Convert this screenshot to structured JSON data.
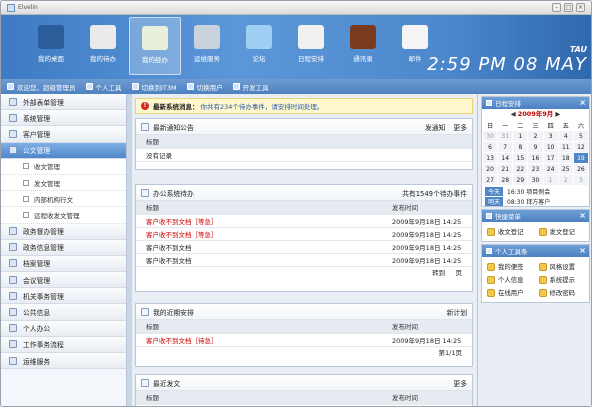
{
  "window": {
    "title": "Elvelin",
    "controls": [
      "–",
      "□",
      "×"
    ]
  },
  "nav": [
    {
      "label": "我的桌面",
      "icon": "monitor-icon",
      "color": "#2a5d99"
    },
    {
      "label": "我的待办",
      "icon": "clock-icon",
      "color": "#eaeaea"
    },
    {
      "label": "我的经办",
      "icon": "checklist-icon",
      "color": "#e8f0dc"
    },
    {
      "label": "运维服务",
      "icon": "gear-icon",
      "color": "#c9d3de"
    },
    {
      "label": "论坛",
      "icon": "speech-bubble-icon",
      "color": "#9fd0f3"
    },
    {
      "label": "日程安排",
      "icon": "calendar-icon",
      "color": "#f1f1f1"
    },
    {
      "label": "通讯录",
      "icon": "book-icon",
      "color": "#7a3b1e"
    },
    {
      "label": "邮件",
      "icon": "envelope-icon",
      "color": "#f4f4f4"
    }
  ],
  "nav_active_index": 2,
  "clock": {
    "day": "TAU",
    "time": "2:59 PM 08 MAY"
  },
  "toolbar": [
    {
      "label": "欢迎您，超级管理员",
      "icon": "user-icon"
    },
    {
      "label": "个人工具",
      "icon": "tools-icon"
    },
    {
      "label": "切换到IT3M",
      "icon": "switch-icon"
    },
    {
      "label": "切换用户",
      "icon": "users-icon"
    },
    {
      "label": "开发工具",
      "icon": "dev-tools-icon"
    }
  ],
  "sidebar": {
    "items": [
      {
        "label": "外部表单管理"
      },
      {
        "label": "系统管理"
      },
      {
        "label": "客户管理"
      },
      {
        "label": "公文管理",
        "open": true
      },
      {
        "label": "收文管理",
        "sub": true
      },
      {
        "label": "发文管理",
        "sub": true
      },
      {
        "label": "内部机构行文",
        "sub": true
      },
      {
        "label": "远程收发文管理",
        "sub": true
      },
      {
        "label": "政务督办管理"
      },
      {
        "label": "政务信息管理"
      },
      {
        "label": "档案管理"
      },
      {
        "label": "会议管理"
      },
      {
        "label": "机关事务管理"
      },
      {
        "label": "公共信息"
      },
      {
        "label": "个人办公"
      },
      {
        "label": "工作事务流程"
      },
      {
        "label": "运维服务"
      }
    ]
  },
  "alert": {
    "title": "最新系统消息：",
    "message": "你共有234个待办事件，请安排时间处理。"
  },
  "notice": {
    "title": "最新通知公告",
    "actions": [
      "发通知",
      "更多"
    ],
    "col": "标题",
    "empty": "没有记录"
  },
  "todo": {
    "title": "办公系统待办",
    "count": "共有1549个待办事件",
    "cols": [
      "标题",
      "发布时间"
    ],
    "rows": [
      {
        "title": "客户收不到文档［等急］",
        "time": "2009年9月18日 14:25",
        "urgent": true
      },
      {
        "title": "客户收不到文档［等急］",
        "time": "2009年9月18日 14:25",
        "urgent": true
      },
      {
        "title": "客户收不到文档",
        "time": "2009年9月18日 14:25",
        "urgent": false
      },
      {
        "title": "客户收不到文档",
        "time": "2009年9月18日 14:25",
        "urgent": false
      }
    ],
    "footer": [
      "转到",
      "页"
    ]
  },
  "schedule": {
    "title": "我的近期安排",
    "action": "新计划",
    "cols": [
      "标题",
      "发布时间"
    ],
    "rows": [
      {
        "title": "客户收不到文档［待急］",
        "time": "2009年9月18日 14:25",
        "urgent": true
      }
    ],
    "footer": "第1/1页"
  },
  "recent": {
    "title": "最近发文",
    "action": "更多",
    "cols": [
      "标题",
      "发布时间"
    ]
  },
  "calendar": {
    "title": "日程安排",
    "month": "2009年9月",
    "weekdays": [
      "日",
      "一",
      "二",
      "三",
      "四",
      "五",
      "六"
    ],
    "weeks": [
      [
        "30",
        "31",
        "1",
        "2",
        "3",
        "4",
        "5"
      ],
      [
        "6",
        "7",
        "8",
        "9",
        "10",
        "11",
        "12"
      ],
      [
        "13",
        "14",
        "15",
        "16",
        "17",
        "18",
        "19"
      ],
      [
        "20",
        "21",
        "22",
        "23",
        "24",
        "25",
        "26"
      ],
      [
        "27",
        "28",
        "29",
        "30",
        "1",
        "2",
        "3"
      ]
    ],
    "today": "19",
    "events": [
      {
        "btn": "今天",
        "text": "16:30 项目例会"
      },
      {
        "btn": "明天",
        "text": "08:30 拜方客户"
      }
    ]
  },
  "quickmenu": {
    "title": "快捷菜单",
    "items": [
      "收文登记",
      "发文登记"
    ]
  },
  "tools": {
    "title": "个人工具条",
    "items": [
      "我的便签",
      "风格设置",
      "个人信息",
      "系统提示",
      "在线用户",
      "修改密码"
    ]
  }
}
